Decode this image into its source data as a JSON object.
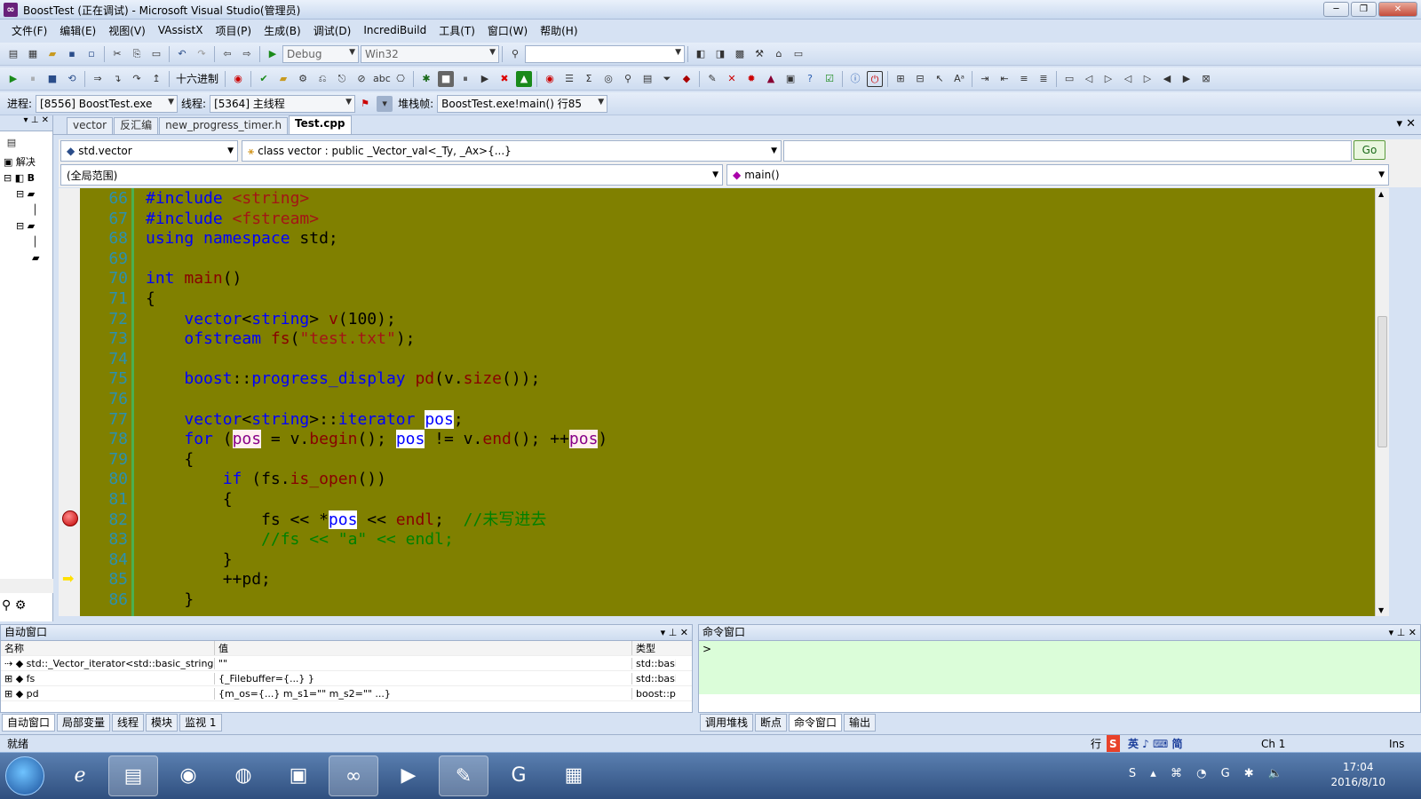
{
  "titlebar": {
    "title": "BoostTest (正在调试) - Microsoft Visual Studio(管理员)"
  },
  "menu": [
    "文件(F)",
    "编辑(E)",
    "视图(V)",
    "VAssistX",
    "项目(P)",
    "生成(B)",
    "调试(D)",
    "IncrediBuild",
    "工具(T)",
    "窗口(W)",
    "帮助(H)"
  ],
  "toolbar1": {
    "config": "Debug",
    "platform": "Win32"
  },
  "toolbar2": {
    "hex_label": "十六进制"
  },
  "debugbar": {
    "process_label": "进程:",
    "process_value": "[8556] BoostTest.exe",
    "thread_label": "线程:",
    "thread_value": "[5364] 主线程",
    "stack_label": "堆栈帧:",
    "stack_value": "BoostTest.exe!main()  行85"
  },
  "left": {
    "solution_label": "解决",
    "b_label": "B"
  },
  "tabs": [
    "vector",
    "反汇编",
    "new_progress_timer.h",
    "Test.cpp"
  ],
  "nav": {
    "type_scope": "std.vector",
    "member": "class vector : public _Vector_val<_Ty, _Ax>{...}",
    "go": "Go",
    "global_scope": "(全局范围)",
    "function": "main()"
  },
  "code": [
    {
      "n": "66",
      "html": "<span class='kw'>#include</span> <span class='st'>&lt;string&gt;</span>"
    },
    {
      "n": "67",
      "html": "<span class='kw'>#include</span> <span class='st'>&lt;fstream&gt;</span>"
    },
    {
      "n": "68",
      "html": "<span class='kw'>using namespace</span> std;"
    },
    {
      "n": "69",
      "html": ""
    },
    {
      "n": "70",
      "html": "<span class='kw'>int</span> <span class='fn'>main</span>()"
    },
    {
      "n": "71",
      "html": "{"
    },
    {
      "n": "72",
      "html": "    <span class='kw'>vector</span>&lt;<span class='kw'>string</span>&gt; <span class='fn'>v</span>(100);"
    },
    {
      "n": "73",
      "html": "    <span class='kw'>ofstream</span> <span class='fn'>fs</span>(<span class='st'>\"test.txt\"</span>);"
    },
    {
      "n": "74",
      "html": ""
    },
    {
      "n": "75",
      "html": "    <span class='kw'>boost</span>::<span class='kw'>progress_display</span> <span class='fn'>pd</span>(v.<span class='fn'>size</span>());"
    },
    {
      "n": "76",
      "html": ""
    },
    {
      "n": "77",
      "html": "    <span class='kw'>vector</span>&lt;<span class='kw'>string</span>&gt;::<span class='kw'>iterator</span> <span class='hl'>pos</span>;"
    },
    {
      "n": "78",
      "html": "    <span class='kw'>for</span> (<span class='hl2'>pos</span> = v.<span class='fn'>begin</span>(); <span class='hl'>pos</span> != v.<span class='fn'>end</span>(); ++<span class='hl2'>pos</span>)"
    },
    {
      "n": "79",
      "html": "    {"
    },
    {
      "n": "80",
      "html": "        <span class='kw'>if</span> (fs.<span class='fn'>is_open</span>())"
    },
    {
      "n": "81",
      "html": "        {"
    },
    {
      "n": "82",
      "html": "            fs &lt;&lt; *<span class='hl'>pos</span> &lt;&lt; <span class='fn'>endl</span>;  <span class='cm'>//未写进去</span>"
    },
    {
      "n": "83",
      "html": "            <span class='cm'>//fs &lt;&lt; \"a\" &lt;&lt; endl;</span>"
    },
    {
      "n": "84",
      "html": "        }"
    },
    {
      "n": "85",
      "html": "        ++pd;"
    },
    {
      "n": "86",
      "html": "    }"
    }
  ],
  "autos": {
    "title": "自动窗口",
    "headers": [
      "名称",
      "值",
      "类型"
    ],
    "rows": [
      {
        "name": "std::_Vector_iterator<std::basic_string<c",
        "value": "\"\"",
        "type": "std::basic"
      },
      {
        "name": "fs",
        "value": "{_Filebuffer={...} }",
        "type": "std::basic"
      },
      {
        "name": "pd",
        "value": "{m_os={...} m_s1=\"\" m_s2=\"\" ...}",
        "type": "boost::pr"
      }
    ]
  },
  "command": {
    "title": "命令窗口",
    "prompt": ">"
  },
  "bottom_tabs_left": [
    "自动窗口",
    "局部变量",
    "线程",
    "模块",
    "监视 1"
  ],
  "bottom_tabs_right": [
    "调用堆栈",
    "断点",
    "命令窗口",
    "输出"
  ],
  "status": {
    "left": "就绪",
    "row_label": "行",
    "col": "Ch 1",
    "ins": "Ins",
    "ime": "英 ♪ ⌨ 简"
  },
  "taskbar": {
    "time": "17:04",
    "date": "2016/8/10"
  }
}
